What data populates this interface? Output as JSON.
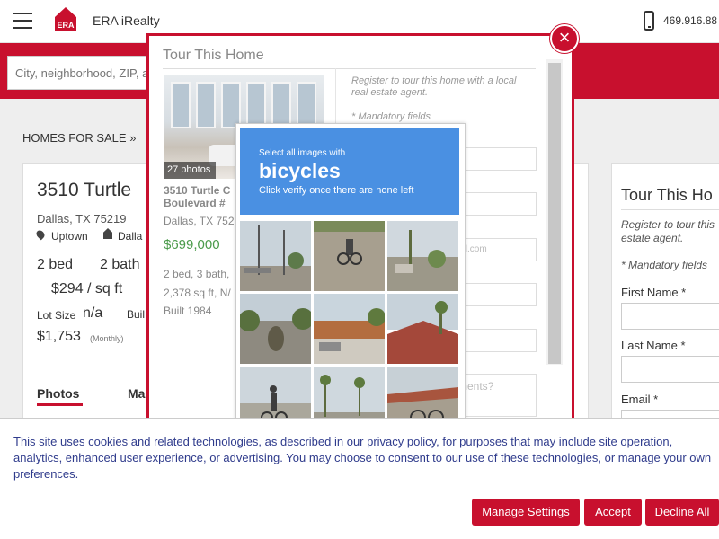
{
  "header": {
    "brand": "ERA iRealty",
    "logo_text": "ERA",
    "phone": "469.916.88"
  },
  "search": {
    "placeholder": "City, neighborhood, ZIP, a"
  },
  "breadcrumb": {
    "text": "HOMES FOR SALE  »"
  },
  "listing": {
    "title": "3510 Turtle",
    "city": "Dallas, TX 75219",
    "neighborhood": "Uptown",
    "city_short": "Dalla",
    "beds": "2 bed",
    "baths": "2 bath",
    "price_per_sqft": "$294 / sq ft",
    "lot_label": "Lot Size",
    "lot_value": "n/a",
    "built_label": "Buil",
    "hoa": "$1,753",
    "hoa_period": "(Monthly)",
    "tabs": [
      "Photos",
      "Ma"
    ]
  },
  "right_form": {
    "title": "Tour This Ho",
    "register": "Register to tour this estate agent.",
    "mandatory": "* Mandatory fields",
    "first_name": "First Name *",
    "last_name": "Last Name *",
    "email": "Email *"
  },
  "modal": {
    "title": "Tour This Home",
    "photos_count": "27 photos",
    "address_line1": "3510 Turtle C",
    "address_line2": "Boulevard #",
    "city": "Dallas, TX 752",
    "price": "$699,000",
    "beds_baths": "2 bed, 3 bath,",
    "sqft": "2,378 sq ft, N/",
    "built": "Built 1984",
    "register": "Register to tour this home with a local real estate agent.",
    "mandatory": "* Mandatory fields",
    "email_placeholder": "ail.com",
    "comments_placeholder": "ments?",
    "close": "×"
  },
  "captcha": {
    "instruction": "Select all images with",
    "target": "bicycles",
    "hint": "Click verify once there are none left"
  },
  "cookie": {
    "text": "This site uses cookies and related technologies, as described in our privacy policy, for purposes that may include site operation, analytics, enhanced user experience, or advertising. You may choose to consent to our use of these technologies, or manage your own preferences.",
    "manage": "Manage Settings",
    "accept": "Accept",
    "decline": "Decline All"
  },
  "colors": {
    "brand_red": "#c8102e",
    "captcha_blue": "#4a90e2",
    "price_green": "#4a9a4a",
    "cookie_text": "#2f3b8c"
  }
}
